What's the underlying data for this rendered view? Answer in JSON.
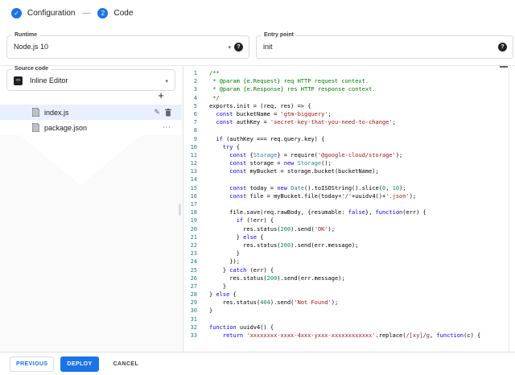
{
  "stepper": {
    "steps": [
      {
        "label": "Configuration",
        "state": "completed"
      },
      {
        "label": "Code",
        "state": "current",
        "number": "2"
      }
    ],
    "separator": "—"
  },
  "fields": {
    "runtime": {
      "label": "Runtime",
      "value": "Node.js 10"
    },
    "entry_point": {
      "label": "Entry point",
      "value": "init"
    }
  },
  "source_code": {
    "label": "Source code",
    "value": "Inline Editor"
  },
  "file_explorer": {
    "files": [
      {
        "name": "index.js",
        "selected": true
      },
      {
        "name": "package.json",
        "selected": false
      }
    ]
  },
  "footer": {
    "previous": "PREVIOUS",
    "deploy": "DEPLOY",
    "cancel": "CANCEL"
  },
  "icons": {
    "check": "✓",
    "help": "?",
    "caret": "▾",
    "plus": "+",
    "pencil": "✎",
    "more": "⋯",
    "inline_editor": "<>"
  },
  "colors": {
    "accent": "#1a73e8",
    "selected_row": "#e8f0fe",
    "line_number": "#237893",
    "code_keyword": "#0000ff",
    "code_string": "#a31515",
    "code_comment": "#008000",
    "code_number": "#098658",
    "code_type": "#267f99",
    "code_regex": "#811f3f"
  },
  "code": {
    "language": "javascript",
    "lines": [
      [
        [
          "c",
          "/**"
        ]
      ],
      [
        [
          "c",
          " * @param {e.Request} req HTTP request context."
        ]
      ],
      [
        [
          "c",
          " * @param {e.Response} res HTTP response context."
        ]
      ],
      [
        [
          "c",
          " */"
        ]
      ],
      [
        [
          "d",
          "exports.init = (req, res) => {"
        ]
      ],
      [
        [
          "d",
          "  "
        ],
        [
          "k",
          "const"
        ],
        [
          "d",
          " bucketName = "
        ],
        [
          "s",
          "'gtm-bigquery'"
        ],
        [
          "d",
          ";"
        ]
      ],
      [
        [
          "d",
          "  "
        ],
        [
          "k",
          "const"
        ],
        [
          "d",
          " authKey = "
        ],
        [
          "s",
          "'secret-key-that-you-need-to-change'"
        ],
        [
          "d",
          ";"
        ]
      ],
      [],
      [
        [
          "d",
          "  "
        ],
        [
          "k",
          "if"
        ],
        [
          "d",
          " (authKey === req.query.key) {"
        ]
      ],
      [
        [
          "d",
          "    "
        ],
        [
          "k",
          "try"
        ],
        [
          "d",
          " {"
        ]
      ],
      [
        [
          "d",
          "      "
        ],
        [
          "k",
          "const"
        ],
        [
          "d",
          " {"
        ],
        [
          "t",
          "Storage"
        ],
        [
          "d",
          "} = require("
        ],
        [
          "s",
          "'@google-cloud/storage'"
        ],
        [
          "d",
          ");"
        ]
      ],
      [
        [
          "d",
          "      "
        ],
        [
          "k",
          "const"
        ],
        [
          "d",
          " storage = "
        ],
        [
          "k",
          "new"
        ],
        [
          "d",
          " "
        ],
        [
          "t",
          "Storage"
        ],
        [
          "d",
          "();"
        ]
      ],
      [
        [
          "d",
          "      "
        ],
        [
          "k",
          "const"
        ],
        [
          "d",
          " myBucket = storage.bucket(bucketName);"
        ]
      ],
      [],
      [
        [
          "d",
          "      "
        ],
        [
          "k",
          "const"
        ],
        [
          "d",
          " today = "
        ],
        [
          "k",
          "new"
        ],
        [
          "d",
          " "
        ],
        [
          "t",
          "Date"
        ],
        [
          "d",
          "().toISOString().slice("
        ],
        [
          "n",
          "0"
        ],
        [
          "d",
          ", "
        ],
        [
          "n",
          "10"
        ],
        [
          "d",
          ");"
        ]
      ],
      [
        [
          "d",
          "      "
        ],
        [
          "k",
          "const"
        ],
        [
          "d",
          " file = myBucket.file(today+"
        ],
        [
          "s",
          "'/'"
        ],
        [
          "d",
          "+uuidv4()+"
        ],
        [
          "s",
          "'.json'"
        ],
        [
          "d",
          ");"
        ]
      ],
      [],
      [
        [
          "d",
          "      file.save(req.rawBody, {resumable: "
        ],
        [
          "k",
          "false"
        ],
        [
          "d",
          "}, "
        ],
        [
          "k",
          "function"
        ],
        [
          "d",
          "(err) {"
        ]
      ],
      [
        [
          "d",
          "        "
        ],
        [
          "k",
          "if"
        ],
        [
          "d",
          " (!err) {"
        ]
      ],
      [
        [
          "d",
          "          res.status("
        ],
        [
          "n",
          "200"
        ],
        [
          "d",
          ").send("
        ],
        [
          "s",
          "'OK'"
        ],
        [
          "d",
          ");"
        ]
      ],
      [
        [
          "d",
          "        } "
        ],
        [
          "k",
          "else"
        ],
        [
          "d",
          " {"
        ]
      ],
      [
        [
          "d",
          "          res.status("
        ],
        [
          "n",
          "200"
        ],
        [
          "d",
          ").send(err.message);"
        ]
      ],
      [
        [
          "d",
          "        }"
        ]
      ],
      [
        [
          "d",
          "      });"
        ]
      ],
      [
        [
          "d",
          "    } "
        ],
        [
          "k",
          "catch"
        ],
        [
          "d",
          " (err) {"
        ]
      ],
      [
        [
          "d",
          "      res.status("
        ],
        [
          "n",
          "200"
        ],
        [
          "d",
          ").send(err.message);"
        ]
      ],
      [
        [
          "d",
          "    }"
        ]
      ],
      [
        [
          "d",
          "} "
        ],
        [
          "k",
          "else"
        ],
        [
          "d",
          " {"
        ]
      ],
      [
        [
          "d",
          "    res.status("
        ],
        [
          "n",
          "404"
        ],
        [
          "d",
          ").send("
        ],
        [
          "s",
          "'Not Found'"
        ],
        [
          "d",
          ");"
        ]
      ],
      [
        [
          "d",
          "}"
        ]
      ],
      [],
      [
        [
          "k",
          "function"
        ],
        [
          "d",
          " uuidv4() {"
        ]
      ],
      [
        [
          "d",
          "    "
        ],
        [
          "k",
          "return"
        ],
        [
          "d",
          " "
        ],
        [
          "s",
          "'xxxxxxxx-xxxx-4xxx-yxxx-xxxxxxxxxxxx'"
        ],
        [
          "d",
          ".replace("
        ],
        [
          "r",
          "/[xy]/g"
        ],
        [
          "d",
          ", "
        ],
        [
          "k",
          "function"
        ],
        [
          "d",
          "(c) {"
        ]
      ]
    ]
  }
}
